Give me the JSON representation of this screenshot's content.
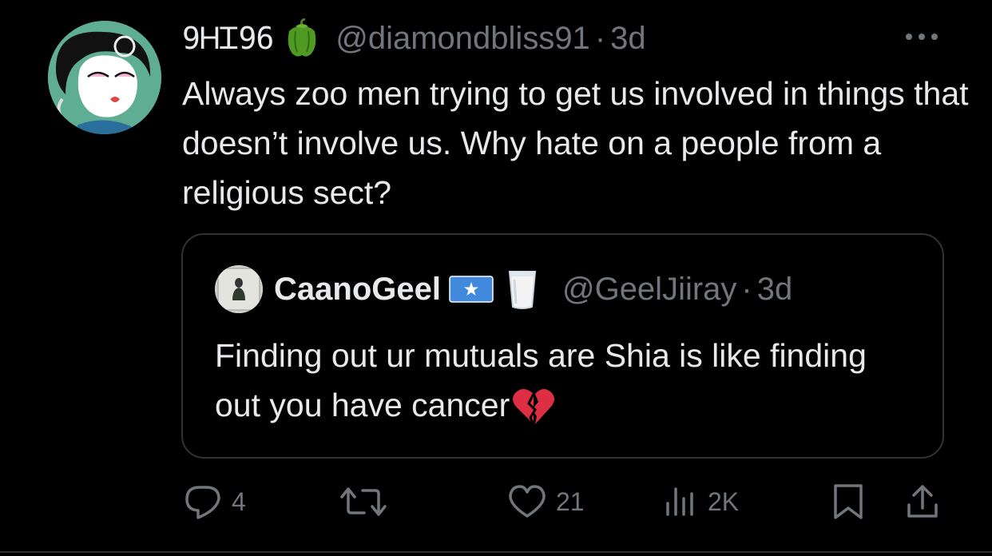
{
  "colors": {
    "background": "#000000",
    "text": "#e7e9ea",
    "muted": "#71767b",
    "border": "#2f3336"
  },
  "tweet": {
    "display_name": "9ᎻᏆ96",
    "name_emoji": "bell-pepper-icon",
    "handle": "@diamondbliss91",
    "separator": "·",
    "time": "3d",
    "text": "Always zoo men trying to get us involved in things that doesn’t involve us. Why hate on a people from a religious sect?"
  },
  "quote": {
    "display_name": "CaanoGeel",
    "name_emojis": [
      "somalia-flag-icon",
      "milk-glass-icon"
    ],
    "handle": "@GeelJiiray",
    "separator": "·",
    "time": "3d",
    "text": "Finding out ur mutuals are Shia is like finding out you have cancer",
    "trailing_emoji": "broken-heart-icon"
  },
  "actions": {
    "reply_count": "4",
    "retweet_count": "",
    "like_count": "21",
    "views_count": "2K"
  }
}
